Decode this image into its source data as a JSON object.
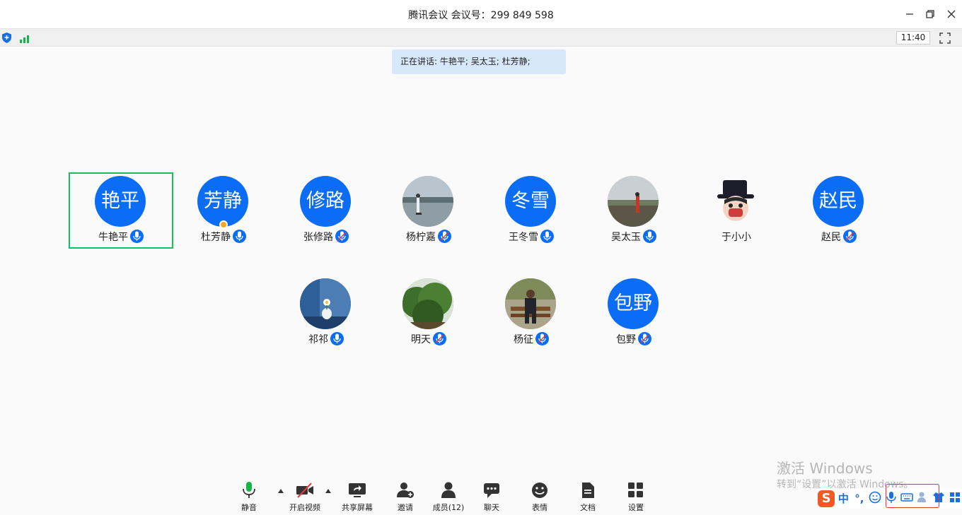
{
  "window": {
    "title": "腾讯会议  会议号：299 849 598",
    "minimize_icon": "minimize-icon",
    "restore_icon": "restore-icon",
    "close_icon": "close-icon"
  },
  "status": {
    "time": "11:40"
  },
  "speaking_banner": "正在讲话: 牛艳平; 吴太玉; 杜芳静;",
  "participants": [
    {
      "initials": "艳平",
      "name": "牛艳平",
      "mic": "active",
      "active_speaker": true
    },
    {
      "initials": "芳静",
      "name": "杜芳静",
      "mic": "active",
      "host": true
    },
    {
      "initials": "修路",
      "name": "张修路",
      "mic": "muted"
    },
    {
      "initials": "",
      "name": "杨柠嘉",
      "mic": "muted",
      "photo": "lake-photo"
    },
    {
      "initials": "冬雪",
      "name": "王冬雪",
      "mic": "active"
    },
    {
      "initials": "",
      "name": "吴太玉",
      "mic": "active",
      "photo": "beach-photo"
    },
    {
      "initials": "",
      "name": "于小小",
      "mic": "none",
      "photo": "cartoon-hat-photo"
    },
    {
      "initials": "赵民",
      "name": "赵民",
      "mic": "muted"
    },
    {
      "initials": "",
      "name": "祁祁",
      "mic": "active",
      "photo": "flower-vase-photo"
    },
    {
      "initials": "",
      "name": "明天",
      "mic": "muted",
      "photo": "trees-photo"
    },
    {
      "initials": "",
      "name": "杨征",
      "mic": "muted",
      "photo": "bench-man-photo"
    },
    {
      "initials": "包野",
      "name": "包野",
      "mic": "muted"
    }
  ],
  "toolbar": {
    "mute_label": "静音",
    "video_label": "开启视频",
    "share_label": "共享屏幕",
    "invite_label": "邀请",
    "members_label": "成员(12)",
    "chat_label": "聊天",
    "emoji_label": "表情",
    "docs_label": "文档",
    "settings_label": "设置"
  },
  "watermark": {
    "line1": "激活 Windows",
    "line2": "转到“设置”以激活 Windows。"
  },
  "ime": {
    "logo": "S",
    "mode": "中",
    "punct": "°,"
  },
  "colors": {
    "accent": "#0b6cf5",
    "active_border": "#16c15c",
    "banner": "#d8e8fb",
    "mic_on": "#18b24b"
  }
}
